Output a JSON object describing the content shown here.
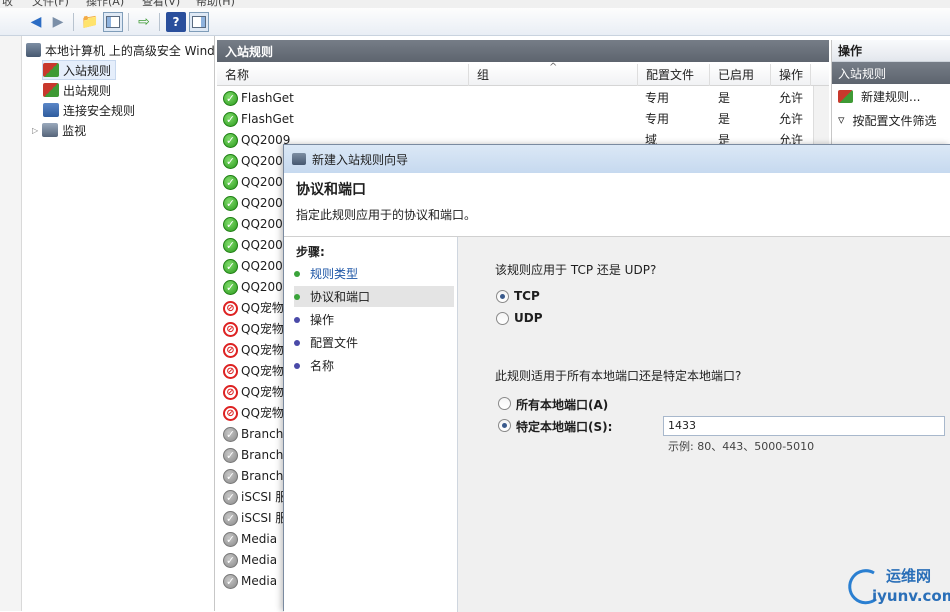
{
  "menubar": {
    "items": [
      "文件(F)",
      "操作(A)",
      "查看(V)",
      "帮助(H)"
    ],
    "left_cut": "收"
  },
  "toolbar": {
    "icons": [
      "back-arrow-icon",
      "forward-arrow-icon",
      "up-folder-icon",
      "show-hide-tree-icon",
      "export-list-icon",
      "help-icon",
      "show-action-pane-icon"
    ]
  },
  "tree": {
    "root": "本地计算机 上的高级安全 Wind",
    "items": [
      {
        "label": "入站规则",
        "selected": true
      },
      {
        "label": "出站规则"
      },
      {
        "label": "连接安全规则"
      },
      {
        "label": "监视"
      }
    ]
  },
  "middle": {
    "title": "入站规则",
    "columns": [
      "名称",
      "组",
      "配置文件",
      "已启用",
      "操作"
    ],
    "sort_glyph": "^",
    "rows": [
      {
        "name": "FlashGet",
        "profile": "专用",
        "enabled": "是",
        "action": "允许",
        "status": "ok"
      },
      {
        "name": "FlashGet",
        "profile": "专用",
        "enabled": "是",
        "action": "允许",
        "status": "ok"
      },
      {
        "name": "QQ2009",
        "profile": "域",
        "enabled": "是",
        "action": "允许",
        "status": "ok"
      },
      {
        "name": "QQ200",
        "status": "ok"
      },
      {
        "name": "QQ200",
        "status": "ok"
      },
      {
        "name": "QQ200",
        "status": "ok"
      },
      {
        "name": "QQ200",
        "status": "ok"
      },
      {
        "name": "QQ200",
        "status": "ok"
      },
      {
        "name": "QQ200",
        "status": "ok"
      },
      {
        "name": "QQ200",
        "status": "ok"
      },
      {
        "name": "QQ宠物",
        "status": "block"
      },
      {
        "name": "QQ宠物",
        "status": "block"
      },
      {
        "name": "QQ宠物",
        "status": "block"
      },
      {
        "name": "QQ宠物",
        "status": "block"
      },
      {
        "name": "QQ宠物",
        "status": "block"
      },
      {
        "name": "QQ宠物",
        "status": "block"
      },
      {
        "name": "Branch",
        "status": "disabled"
      },
      {
        "name": "Branch",
        "status": "disabled"
      },
      {
        "name": "Branch",
        "status": "disabled"
      },
      {
        "name": "iSCSI 服",
        "status": "disabled"
      },
      {
        "name": "iSCSI 服",
        "status": "disabled"
      },
      {
        "name": "Media",
        "status": "disabled"
      },
      {
        "name": "Media",
        "status": "disabled"
      },
      {
        "name": "Media",
        "status": "disabled"
      }
    ]
  },
  "right": {
    "title": "操作",
    "section": "入站规则",
    "actions": [
      "新建规则...",
      "按配置文件筛选"
    ]
  },
  "wizard": {
    "window_title": "新建入站规则向导",
    "heading": "协议和端口",
    "subheading": "指定此规则应用于的协议和端口。",
    "steps_label": "步骤:",
    "steps": [
      {
        "label": "规则类型",
        "state": "done"
      },
      {
        "label": "协议和端口",
        "state": "current"
      },
      {
        "label": "操作",
        "state": "pending"
      },
      {
        "label": "配置文件",
        "state": "pending"
      },
      {
        "label": "名称",
        "state": "pending"
      }
    ],
    "q1": "该规则应用于 TCP 还是 UDP?",
    "opt_tcp": "TCP",
    "opt_udp": "UDP",
    "q2": "此规则适用于所有本地端口还是特定本地端口?",
    "opt_all": "所有本地端口(A)",
    "opt_specific": "特定本地端口(S):",
    "port_value": "1433",
    "example": "示例: 80、443、5000-5010"
  },
  "watermark": {
    "text": "运维网",
    "url": "iyunv.com"
  },
  "colors": {
    "accent": "#3a5a8c",
    "ok_green": "#2c9a1e",
    "block_red": "#d22222",
    "step_done": "#3aa33a",
    "step_pending": "#4a4aa8"
  }
}
